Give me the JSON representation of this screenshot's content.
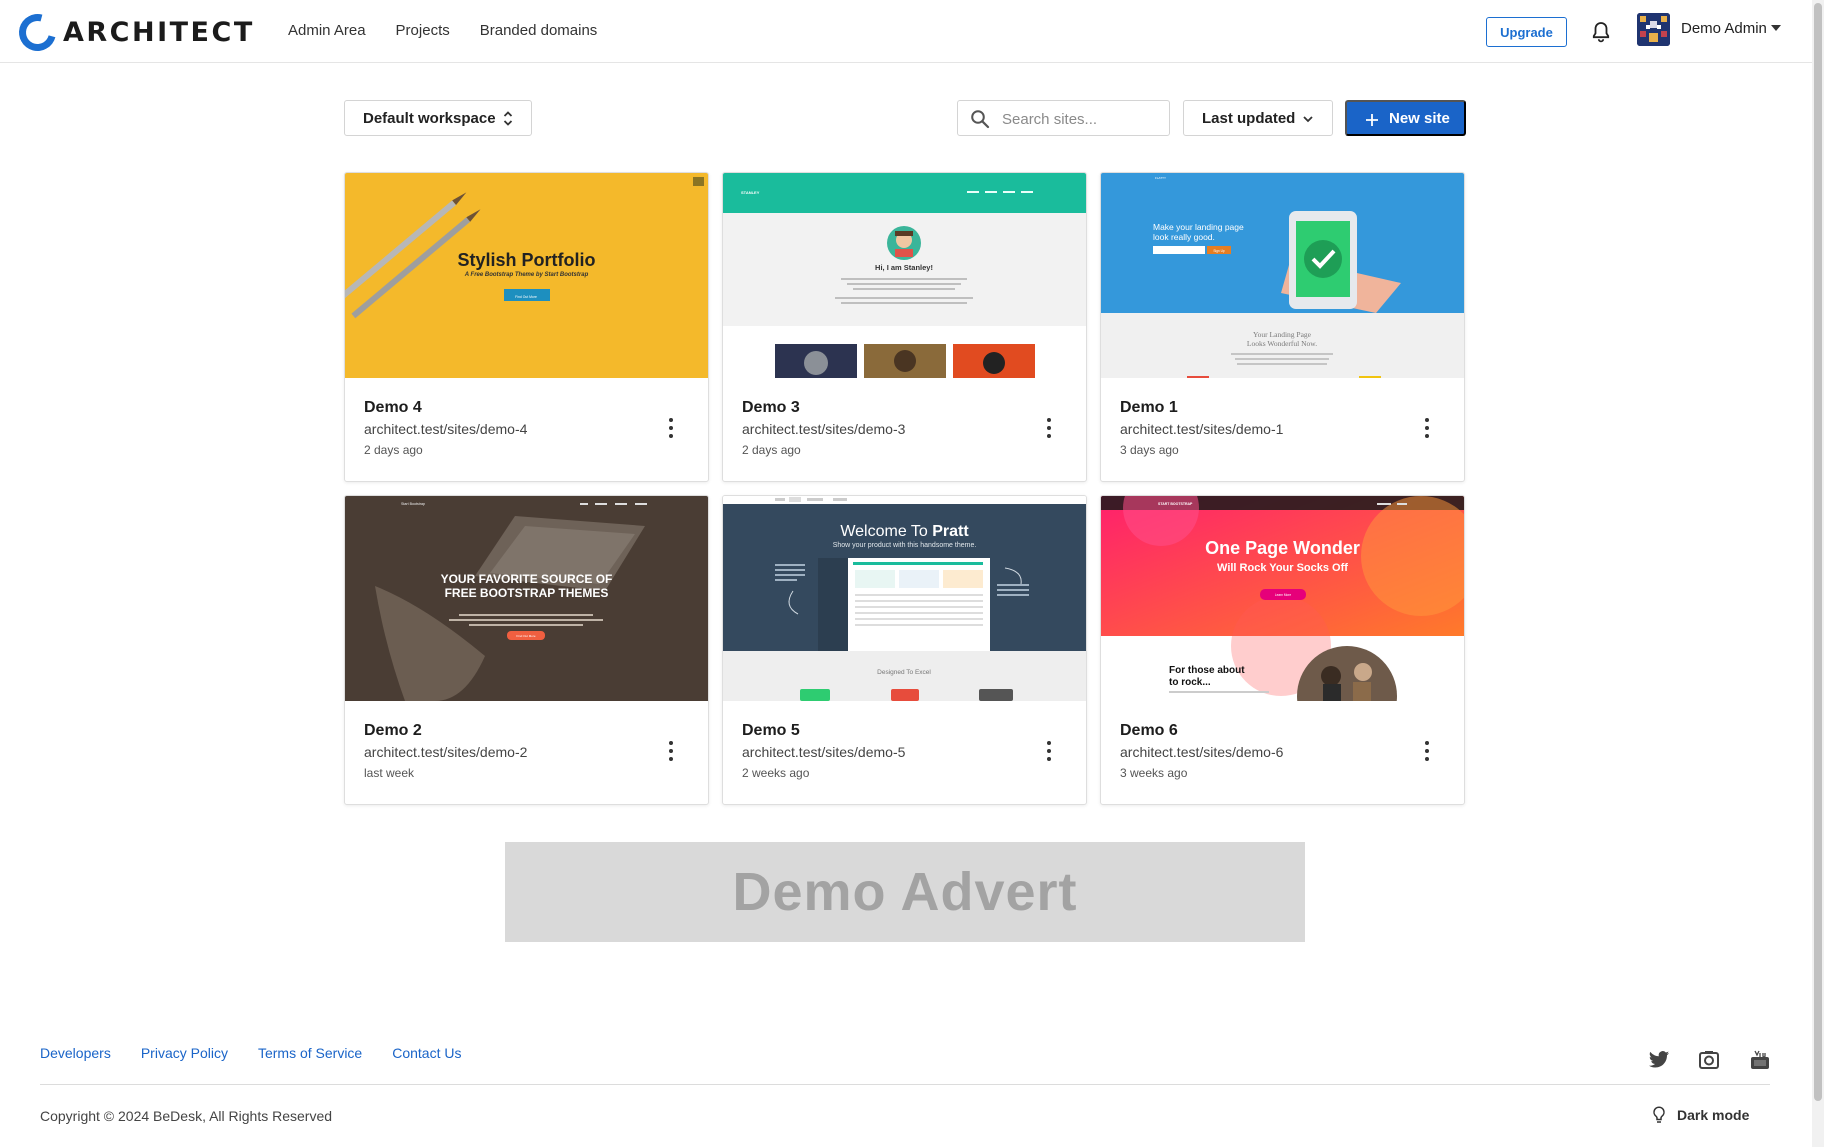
{
  "header": {
    "logo_text": "ARCHITECT",
    "nav": [
      "Admin Area",
      "Projects",
      "Branded domains"
    ],
    "upgrade_label": "Upgrade",
    "user_name": "Demo Admin"
  },
  "toolbar": {
    "workspace_label": "Default workspace",
    "search_placeholder": "Search sites...",
    "sort_label": "Last updated",
    "new_site_label": "New site"
  },
  "sites": [
    {
      "name": "Demo 4",
      "url": "architect.test/sites/demo-4",
      "updated": "2 days ago",
      "thumb": {
        "title": "Stylish Portfolio",
        "subtitle": "A Free Bootstrap Theme by Start Bootstrap",
        "button": "Find Out More"
      }
    },
    {
      "name": "Demo 3",
      "url": "architect.test/sites/demo-3",
      "updated": "2 days ago",
      "thumb": {
        "brand": "STANLEY",
        "title": "Hi, I am Stanley!"
      }
    },
    {
      "name": "Demo 1",
      "url": "architect.test/sites/demo-1",
      "updated": "3 days ago",
      "thumb": {
        "brand": "FLATTY",
        "title_line1": "Make your landing page",
        "title_line2": "look really good.",
        "button": "Sign Up",
        "section_line1": "Your Landing Page",
        "section_line2": "Looks Wonderful Now."
      }
    },
    {
      "name": "Demo 2",
      "url": "architect.test/sites/demo-2",
      "updated": "last week",
      "thumb": {
        "brand": "Start Bootstrap",
        "title_line1": "YOUR FAVORITE SOURCE OF",
        "title_line2": "FREE BOOTSTRAP THEMES",
        "button": "Find Out More"
      }
    },
    {
      "name": "Demo 5",
      "url": "architect.test/sites/demo-5",
      "updated": "2 weeks ago",
      "thumb": {
        "title_prefix": "Welcome To ",
        "title_bold": "Pratt",
        "subtitle": "Show your product with this handsome theme.",
        "section": "Designed To Excel"
      }
    },
    {
      "name": "Demo 6",
      "url": "architect.test/sites/demo-6",
      "updated": "3 weeks ago",
      "thumb": {
        "brand": "START BOOTSTRAP",
        "title": "One Page Wonder",
        "subtitle": "Will Rock Your Socks Off",
        "button": "Learn More",
        "section_line1": "For those about",
        "section_line2": "to rock..."
      }
    }
  ],
  "advert": "Demo Advert",
  "footer": {
    "links": [
      "Developers",
      "Privacy Policy",
      "Terms of Service",
      "Contact Us"
    ],
    "copyright": "Copyright © 2024 BeDesk, All Rights Reserved",
    "dark_mode_label": "Dark mode",
    "social_icons": [
      "twitter-icon",
      "instagram-icon",
      "youtube-icon"
    ]
  },
  "colors": {
    "primary": "#1a64c8",
    "advert_bg": "#d9d9d9"
  }
}
